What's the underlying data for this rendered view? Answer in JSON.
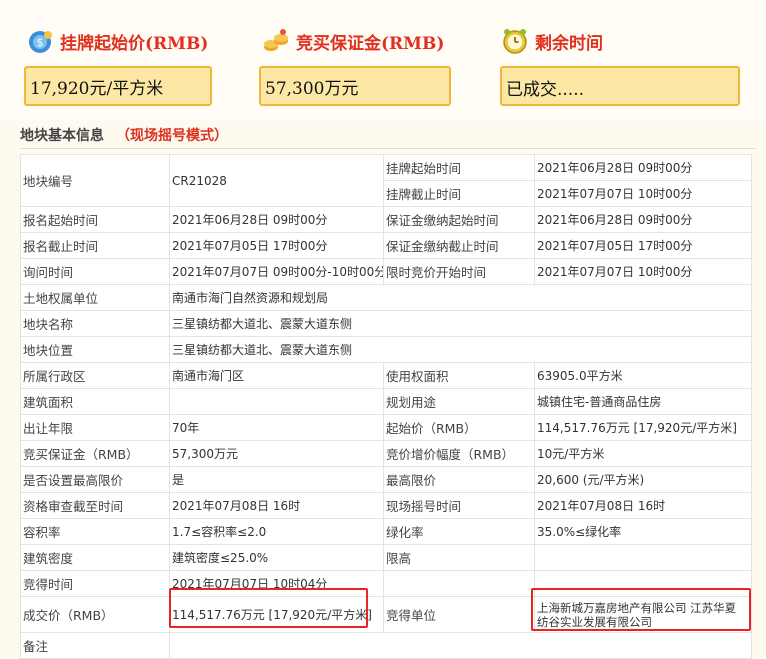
{
  "header": {
    "start_price_label": "挂牌起始价(RMB)",
    "deposit_label": "竞买保证金(RMB)",
    "remaining_label": "剩余时间",
    "start_price_value": "17,920元/平方米",
    "deposit_value": "57,300万元",
    "remaining_value": "已成交....."
  },
  "section": {
    "title": "地块基本信息",
    "mode": "（现场摇号模式）"
  },
  "table": {
    "r1": {
      "k1": "地块编号",
      "v1": "CR21028",
      "k2": "挂牌起始时间",
      "v2": "2021年06月28日 09时00分"
    },
    "r2": {
      "k2": "挂牌截止时间",
      "v2": "2021年07月07日 10时00分"
    },
    "r3": {
      "k1": "报名起始时间",
      "v1": "2021年06月28日 09时00分",
      "k2": "保证金缴纳起始时间",
      "v2": "2021年06月28日 09时00分"
    },
    "r4": {
      "k1": "报名截止时间",
      "v1": "2021年07月05日 17时00分",
      "k2": "保证金缴纳截止时间",
      "v2": "2021年07月05日 17时00分"
    },
    "r5": {
      "k1": "询问时间",
      "v1": "2021年07月07日 09时00分-10时00分",
      "k2": "限时竞价开始时间",
      "v2": "2021年07月07日 10时00分"
    },
    "r6": {
      "k1": "土地权属单位",
      "v1": "南通市海门自然资源和规划局"
    },
    "r7": {
      "k1": "地块名称",
      "v1": "三星镇纺都大道北、震蒙大道东侧"
    },
    "r8": {
      "k1": "地块位置",
      "v1": "三星镇纺都大道北、震蒙大道东侧"
    },
    "r9": {
      "k1": "所属行政区",
      "v1": "南通市海门区",
      "k2": "使用权面积",
      "v2": "63905.0平方米"
    },
    "r10": {
      "k1": "建筑面积",
      "v1": "",
      "k2": "规划用途",
      "v2": "城镇住宅-普通商品住房"
    },
    "r11": {
      "k1": "出让年限",
      "v1": "70年",
      "k2": "起始价（RMB）",
      "v2": "114,517.76万元 [17,920元/平方米]"
    },
    "r12": {
      "k1": "竞买保证金（RMB）",
      "v1": "57,300万元",
      "k2": "竞价增价幅度（RMB）",
      "v2": "10元/平方米"
    },
    "r13": {
      "k1": "是否设置最高限价",
      "v1": "是",
      "k2": "最高限价",
      "v2": "20,600 (元/平方米)"
    },
    "r14": {
      "k1": "资格审查截至时间",
      "v1": "2021年07月08日 16时",
      "k2": "现场摇号时间",
      "v2": "2021年07月08日 16时"
    },
    "r15": {
      "k1": "容积率",
      "v1": "1.7≤容积率≤2.0",
      "k2": "绿化率",
      "v2": "35.0%≤绿化率"
    },
    "r16": {
      "k1": "建筑密度",
      "v1": "建筑密度≤25.0%",
      "k2": "限高",
      "v2": ""
    },
    "r17": {
      "k1": "竞得时间",
      "v1": "2021年07月07日 10时04分"
    },
    "r18": {
      "k1": "成交价（RMB）",
      "v1": "114,517.76万元 [17,920元/平方米]",
      "k2": "竞得单位",
      "v2a": "上海新城万嘉房地产有限公司 江苏华夏",
      "v2b": "纺谷实业发展有限公司"
    },
    "r19": {
      "k1": "备注"
    }
  },
  "icons": {
    "price": "money-bag-icon",
    "deposit": "coins-icon",
    "clock": "alarm-clock-icon"
  },
  "colors": {
    "accent_red": "#e0301e",
    "value_box_bg": "#fde7a4",
    "value_box_border": "#f0b53a",
    "highlight": "#e8232a"
  }
}
